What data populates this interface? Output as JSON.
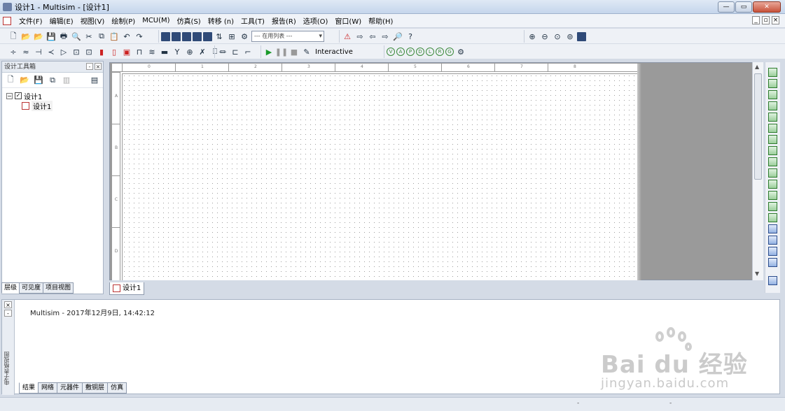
{
  "window": {
    "title": "设计1 - Multisim - [设计1]"
  },
  "menu": [
    "文件(F)",
    "编辑(E)",
    "视图(V)",
    "绘制(P)",
    "MCU(M)",
    "仿真(S)",
    "转移 (n)",
    "工具(T)",
    "报告(R)",
    "选项(O)",
    "窗口(W)",
    "帮助(H)"
  ],
  "toolbar": {
    "in_use_list": "--- 在用列表 ---",
    "interactive_label": "Interactive"
  },
  "design_toolbox": {
    "title": "设计工具箱",
    "tree": {
      "root": "设计1",
      "child": "设计1"
    },
    "tabs": [
      "层级",
      "可见度",
      "项目视图"
    ]
  },
  "canvas": {
    "ruler_x": [
      "0",
      "1",
      "2",
      "3",
      "4",
      "5",
      "6",
      "7",
      "8"
    ],
    "ruler_y": [
      "A",
      "B",
      "C",
      "D"
    ]
  },
  "doc_tab": "设计1",
  "spreadsheet": {
    "side_label": "电子表格视图",
    "log_entry": "Multisim  -  2017年12月9日, 14:42:12",
    "tabs": [
      "结果",
      "网络",
      "元器件",
      "敷铜层",
      "仿真"
    ]
  },
  "watermark": {
    "brand": "Bai du 经验",
    "url": "jingyan.baidu.com"
  }
}
